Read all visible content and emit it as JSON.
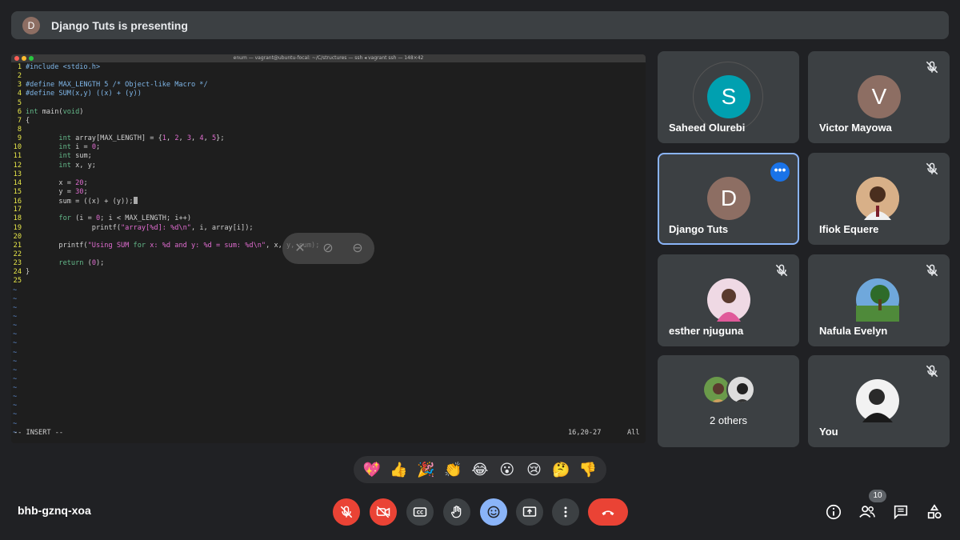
{
  "banner": {
    "avatar_letter": "D",
    "text": "Django Tuts is presenting"
  },
  "terminal": {
    "title": "enum — vagrant@ubuntu-focal: ~/C/structures — ssh ◂ vagrant ssh — 148×42",
    "lines": [
      "#include <stdio.h>",
      "",
      "#define MAX_LENGTH 5 /* Object-like Macro */",
      "#define SUM(x,y) ((x) + (y))",
      "",
      "int main(void)",
      "{",
      "",
      "        int array[MAX_LENGTH] = {1, 2, 3, 4, 5};",
      "        int i = 0;",
      "        int sum;",
      "        int x, y;",
      "",
      "        x = 20;",
      "        y = 30;",
      "        sum = ((x) + (y));",
      "",
      "        for (i = 0; i < MAX_LENGTH; i++)",
      "                printf(\"array[%d]: %d\\n\", i, array[i]);",
      "",
      "        printf(\"Using SUM for x: %d and y: %d = sum: %d\\n\", x, y, sum);",
      "",
      "        return (0);",
      "}",
      ""
    ],
    "tilde": "~",
    "mode": "-- INSERT --",
    "position": "16,20-27",
    "scroll": "All"
  },
  "participants": [
    {
      "name": "Saheed Olurebi",
      "initial": "S",
      "color": "#00a0b0",
      "muted": false
    },
    {
      "name": "Victor Mayowa",
      "initial": "V",
      "color": "#8d6e63",
      "muted": true
    },
    {
      "name": "Django Tuts",
      "initial": "D",
      "color": "#8d6e63",
      "muted": false,
      "active": true
    },
    {
      "name": "Ifiok Equere",
      "muted": true
    },
    {
      "name": "esther njuguna",
      "muted": true
    },
    {
      "name": "Nafula Evelyn",
      "muted": true
    },
    {
      "name": "2 others"
    },
    {
      "name": "You",
      "muted": true
    }
  ],
  "reactions": [
    "💖",
    "👍",
    "🎉",
    "👏",
    "😂",
    "😮",
    "😢",
    "🤔",
    "👎"
  ],
  "meeting_code": "bhb-gznq-xoa",
  "people_count": "10",
  "colors": {
    "red": "#ea4335",
    "blue": "#8ab4f8",
    "accent": "#1a73e8"
  }
}
